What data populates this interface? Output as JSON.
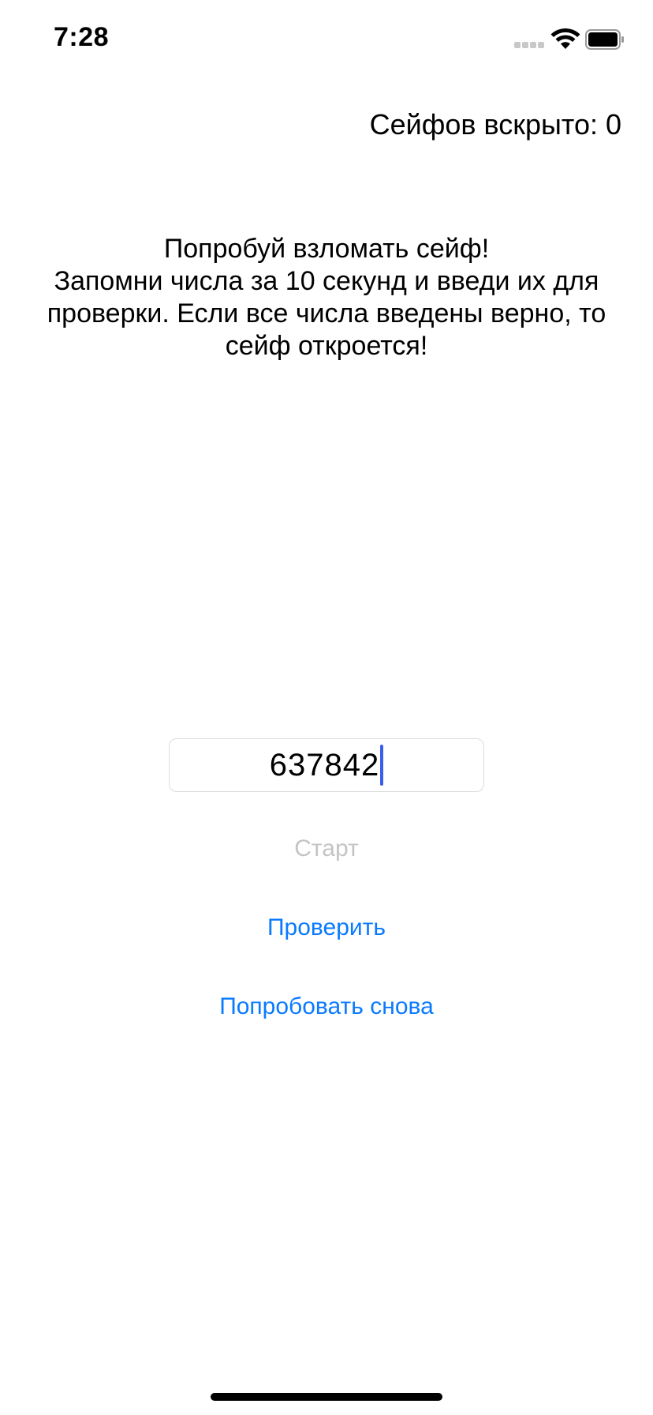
{
  "status_bar": {
    "time": "7:28"
  },
  "counter": {
    "label": "Сейфов вскрыто: 0"
  },
  "instructions": {
    "lines": [
      "Попробуй взломать сейф!",
      "Запомни числа за 10 секунд и введи их для",
      "проверки. Если все числа введены верно, то",
      "сейф откроется!"
    ]
  },
  "code_input": {
    "value": "637842"
  },
  "buttons": {
    "start": "Старт",
    "check": "Проверить",
    "retry": "Попробовать снова"
  },
  "colors": {
    "accent": "#0a7aff",
    "disabled": "#c4c4c7",
    "cursor": "#3b5ee6"
  }
}
